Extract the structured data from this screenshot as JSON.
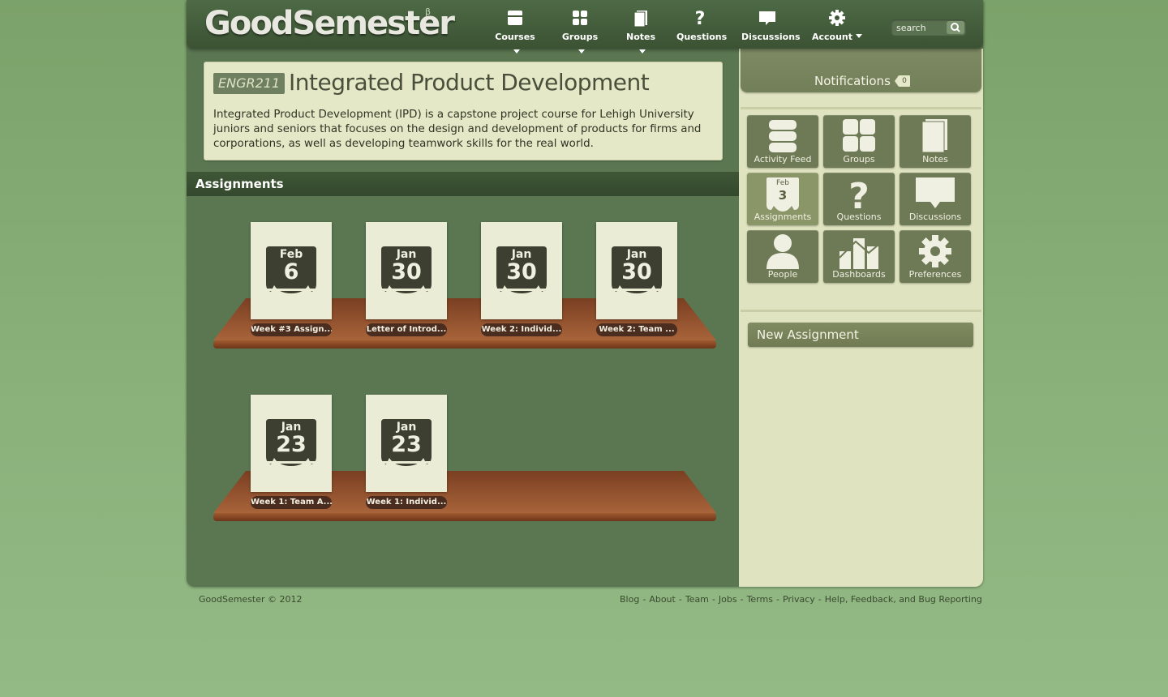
{
  "header": {
    "logo": "GoodSemester",
    "beta": "β",
    "nav": [
      {
        "label": "Courses",
        "icon": "courses-icon",
        "dropdown": true
      },
      {
        "label": "Groups",
        "icon": "groups-icon",
        "dropdown": true
      },
      {
        "label": "Notes",
        "icon": "notes-icon",
        "dropdown": true
      },
      {
        "label": "Questions",
        "icon": "question-icon",
        "dropdown": false
      },
      {
        "label": "Discussions",
        "icon": "speech-bubble-icon",
        "dropdown": false
      },
      {
        "label": "Account",
        "icon": "gear-icon",
        "dropdown": true
      }
    ],
    "search_placeholder": "search"
  },
  "course": {
    "code": "ENGR211",
    "title": "Integrated Product Development",
    "description": "Integrated Product Development (IPD) is a capstone project course for Lehigh University juniors and seniors that focuses on the design and development of products for firms and corporations, as well as developing teamwork skills for the real world."
  },
  "assignments": {
    "heading": "Assignments",
    "items": [
      {
        "month": "Feb",
        "day": "6",
        "label": "Week #3 Assign..."
      },
      {
        "month": "Jan",
        "day": "30",
        "label": "Letter of Introd..."
      },
      {
        "month": "Jan",
        "day": "30",
        "label": "Week 2: Individ..."
      },
      {
        "month": "Jan",
        "day": "30",
        "label": "Week 2: Team ..."
      },
      {
        "month": "Jan",
        "day": "23",
        "label": "Week 1: Team A..."
      },
      {
        "month": "Jan",
        "day": "23",
        "label": "Week 1: Individ..."
      }
    ]
  },
  "sidebar": {
    "notifications_label": "Notifications",
    "notifications_count": "0",
    "tiles": [
      {
        "label": "Activity Feed",
        "icon": "activity-feed-icon"
      },
      {
        "label": "Groups",
        "icon": "groups-icon"
      },
      {
        "label": "Notes",
        "icon": "notes-icon"
      },
      {
        "label": "Assignments",
        "icon": "calendar-icon",
        "month": "Feb",
        "day": "3",
        "active": true
      },
      {
        "label": "Questions",
        "icon": "question-icon"
      },
      {
        "label": "Discussions",
        "icon": "speech-bubble-icon"
      },
      {
        "label": "People",
        "icon": "person-icon"
      },
      {
        "label": "Dashboards",
        "icon": "dashboard-icon"
      },
      {
        "label": "Preferences",
        "icon": "gear-icon"
      }
    ],
    "new_assignment": "New Assignment"
  },
  "footer": {
    "copyright": "GoodSemester © 2012",
    "links": [
      "Blog",
      "About",
      "Team",
      "Jobs",
      "Terms",
      "Privacy",
      "Help, Feedback, and Bug Reporting"
    ]
  },
  "colors": {
    "page_bg": "#8bb27b",
    "frame": "#5a7752",
    "header": "#3b5233",
    "card": "#e4e8c6",
    "sidebar": "#dfe3bf",
    "tile": "#6e7a56",
    "calendar": "#3d4030",
    "shelf": "#8a4f2c"
  }
}
